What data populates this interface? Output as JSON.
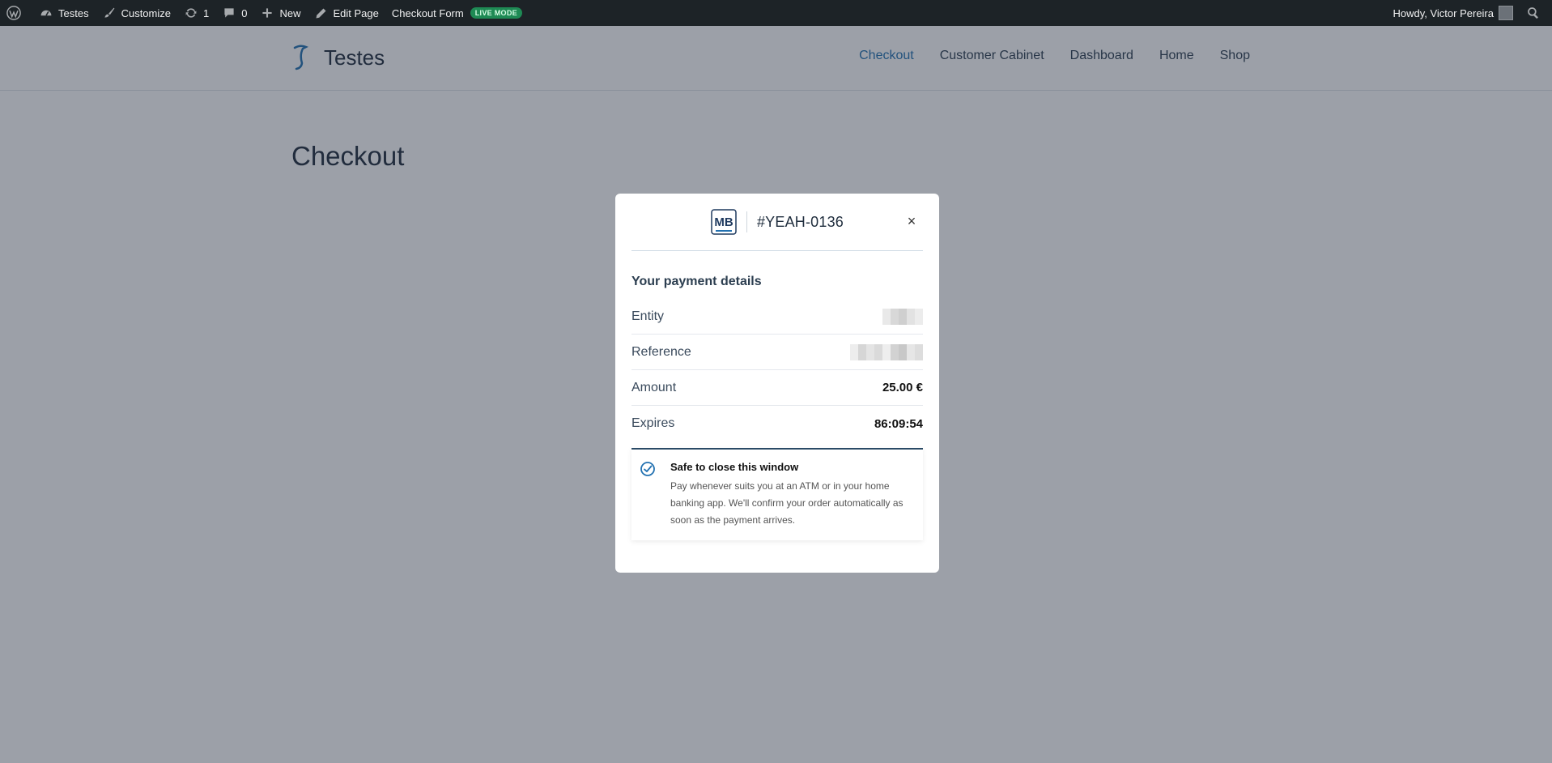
{
  "adminbar": {
    "site_name": "Testes",
    "customize": "Customize",
    "updates_count": "1",
    "comments_count": "0",
    "new_label": "New",
    "edit_page": "Edit Page",
    "checkout_form": "Checkout Form",
    "live_mode": "LIVE MODE",
    "howdy": "Howdy, Victor Pereira"
  },
  "header": {
    "site_title": "Testes",
    "nav": [
      "Checkout",
      "Customer Cabinet",
      "Dashboard",
      "Home",
      "Shop"
    ]
  },
  "page": {
    "title": "Checkout"
  },
  "modal": {
    "order_id": "#YEAH-0136",
    "close_label": "×",
    "section_title": "Your payment details",
    "rows": {
      "entity_label": "Entity",
      "reference_label": "Reference",
      "amount_label": "Amount",
      "amount_value": "25.00 €",
      "expires_label": "Expires",
      "expires_value": "86:09:54"
    },
    "notice": {
      "title": "Safe to close this window",
      "body": "Pay whenever suits you at an ATM or in your home banking app. We'll confirm your order automatically as soon as the payment arrives."
    }
  },
  "colors": {
    "adminbar_bg": "#1d2327",
    "link_active": "#2271b1",
    "live_badge": "#1e8a54",
    "overlay": "rgba(35,44,62,0.45)",
    "notice_border": "#2a4a66"
  },
  "icons": [
    "wordpress-logo-icon",
    "dashboard-icon",
    "brush-icon",
    "refresh-icon",
    "comment-icon",
    "plus-icon",
    "pencil-icon",
    "search-icon",
    "close-icon",
    "check-circle-icon",
    "multibanco-logo"
  ]
}
